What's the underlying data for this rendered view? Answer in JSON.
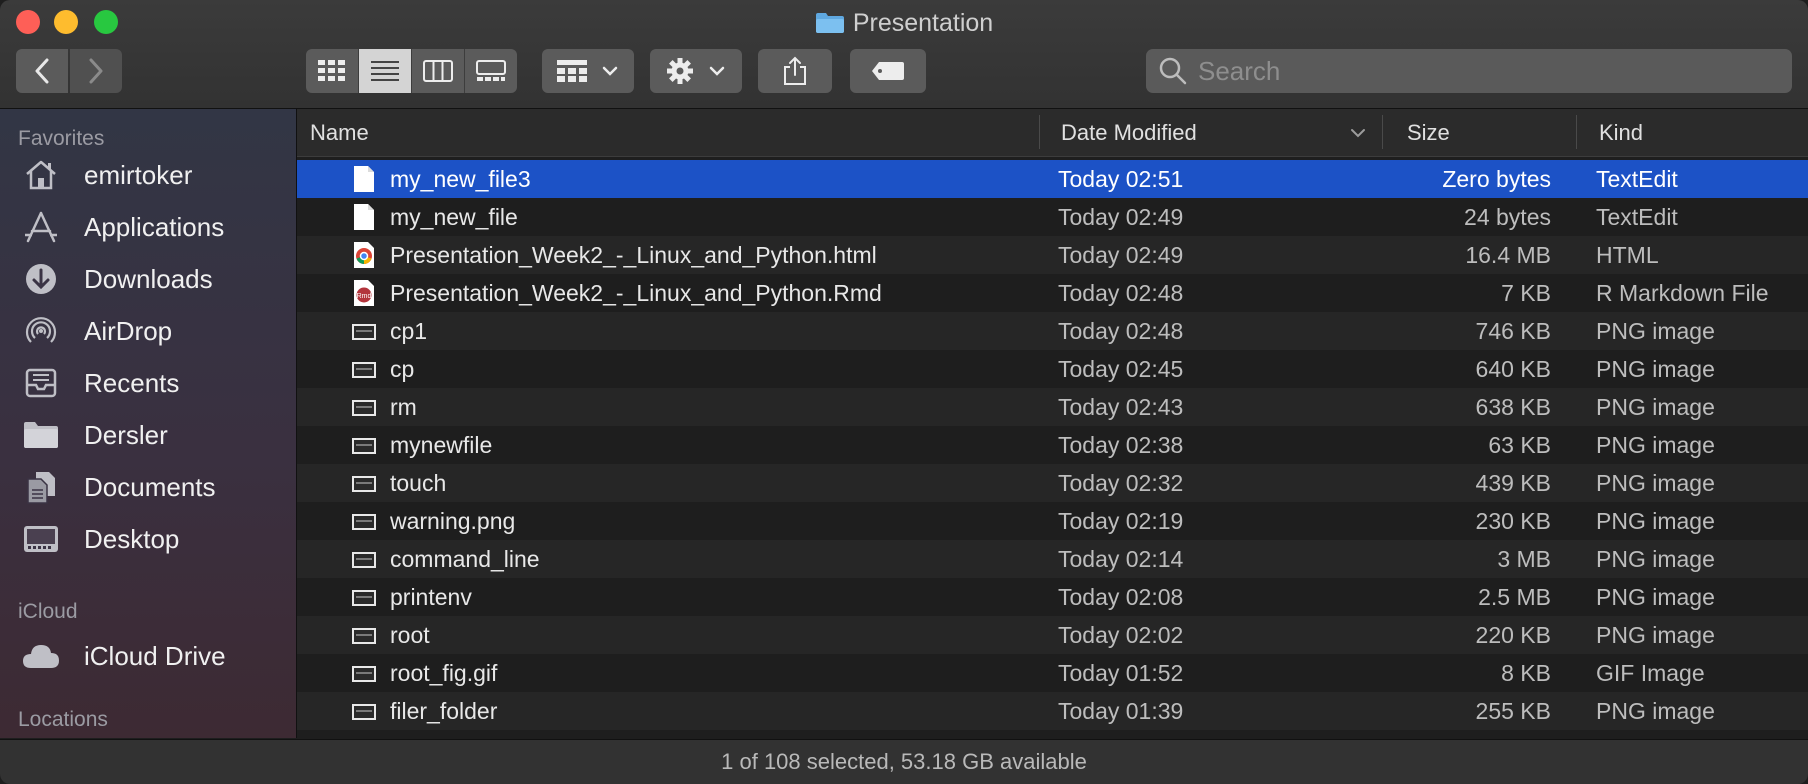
{
  "window": {
    "title": "Presentation"
  },
  "toolbar": {
    "search_placeholder": "Search"
  },
  "sidebar": {
    "favorites_heading": "Favorites",
    "favorites": [
      {
        "label": "emirtoker",
        "icon": "home-icon"
      },
      {
        "label": "Applications",
        "icon": "applications-icon"
      },
      {
        "label": "Downloads",
        "icon": "downloads-icon"
      },
      {
        "label": "AirDrop",
        "icon": "airdrop-icon"
      },
      {
        "label": "Recents",
        "icon": "recents-icon"
      },
      {
        "label": "Dersler",
        "icon": "folder-icon"
      },
      {
        "label": "Documents",
        "icon": "documents-icon"
      },
      {
        "label": "Desktop",
        "icon": "desktop-icon"
      }
    ],
    "icloud_heading": "iCloud",
    "icloud": [
      {
        "label": "iCloud Drive",
        "icon": "cloud-icon"
      }
    ],
    "locations_heading": "Locations"
  },
  "columns": {
    "name": "Name",
    "date": "Date Modified",
    "size": "Size",
    "kind": "Kind"
  },
  "files": [
    {
      "name": "my_new_file3",
      "date": "Today 02:51",
      "size": "Zero bytes",
      "kind": "TextEdit",
      "icon": "document-icon",
      "selected": true
    },
    {
      "name": "my_new_file",
      "date": "Today 02:49",
      "size": "24 bytes",
      "kind": "TextEdit",
      "icon": "document-icon"
    },
    {
      "name": "Presentation_Week2_-_Linux_and_Python.html",
      "date": "Today 02:49",
      "size": "16.4 MB",
      "kind": "HTML",
      "icon": "chrome-icon"
    },
    {
      "name": "Presentation_Week2_-_Linux_and_Python.Rmd",
      "date": "Today 02:48",
      "size": "7 KB",
      "kind": "R Markdown File",
      "icon": "rmd-icon"
    },
    {
      "name": "cp1",
      "date": "Today 02:48",
      "size": "746 KB",
      "kind": "PNG image",
      "icon": "image-icon"
    },
    {
      "name": "cp",
      "date": "Today 02:45",
      "size": "640 KB",
      "kind": "PNG image",
      "icon": "image-icon"
    },
    {
      "name": "rm",
      "date": "Today 02:43",
      "size": "638 KB",
      "kind": "PNG image",
      "icon": "image-icon"
    },
    {
      "name": "mynewfile",
      "date": "Today 02:38",
      "size": "63 KB",
      "kind": "PNG image",
      "icon": "image-icon"
    },
    {
      "name": "touch",
      "date": "Today 02:32",
      "size": "439 KB",
      "kind": "PNG image",
      "icon": "image-icon"
    },
    {
      "name": "warning.png",
      "date": "Today 02:19",
      "size": "230 KB",
      "kind": "PNG image",
      "icon": "image-icon"
    },
    {
      "name": "command_line",
      "date": "Today 02:14",
      "size": "3 MB",
      "kind": "PNG image",
      "icon": "image-icon"
    },
    {
      "name": "printenv",
      "date": "Today 02:08",
      "size": "2.5 MB",
      "kind": "PNG image",
      "icon": "image-icon"
    },
    {
      "name": "root",
      "date": "Today 02:02",
      "size": "220 KB",
      "kind": "PNG image",
      "icon": "image-icon"
    },
    {
      "name": "root_fig.gif",
      "date": "Today 01:52",
      "size": "8 KB",
      "kind": "GIF Image",
      "icon": "image-icon"
    },
    {
      "name": "filer_folder",
      "date": "Today 01:39",
      "size": "255 KB",
      "kind": "PNG image",
      "icon": "image-icon"
    }
  ],
  "status": {
    "text": "1 of 108 selected, 53.18 GB available"
  },
  "colors": {
    "selection": "#1c52c6",
    "sidebar_top": "#323645",
    "sidebar_bottom": "#3d2a33"
  }
}
